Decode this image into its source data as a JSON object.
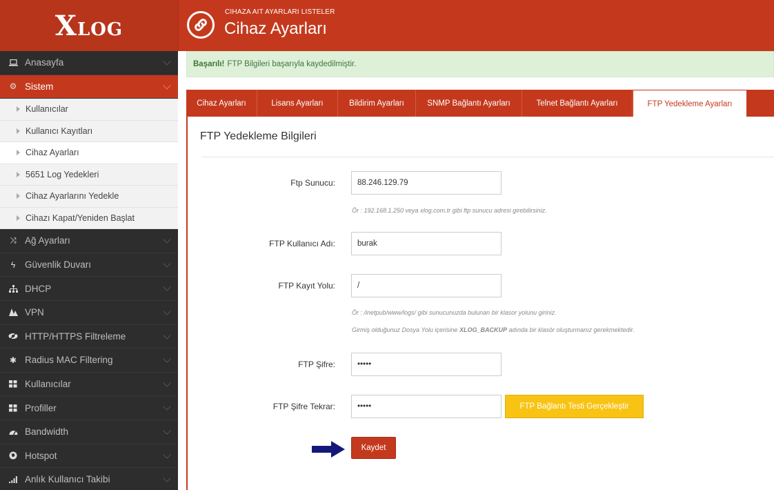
{
  "logo": {
    "initial": "X",
    "rest": "LOG"
  },
  "header": {
    "subtitle": "CIHAZA AIT AYARLARI LISTELER",
    "title": "Cihaz Ayarları"
  },
  "sidebar": {
    "items": [
      {
        "label": "Anasayfa",
        "icon": "laptop-icon"
      },
      {
        "label": "Sistem",
        "icon": "gears-icon",
        "active": true
      },
      {
        "label": "Ağ Ayarları",
        "icon": "random-icon"
      },
      {
        "label": "Güvenlik Duvarı",
        "icon": "bolt-icon"
      },
      {
        "label": "DHCP",
        "icon": "sitemap-icon"
      },
      {
        "label": "VPN",
        "icon": "vpn-icon"
      },
      {
        "label": "HTTP/HTTPS Filtreleme",
        "icon": "eye-slash-icon"
      },
      {
        "label": "Radius MAC Filtering",
        "icon": "asterisk-icon"
      },
      {
        "label": "Kullanıcılar",
        "icon": "th-large-icon"
      },
      {
        "label": "Profiller",
        "icon": "th-large-icon"
      },
      {
        "label": "Bandwidth",
        "icon": "tachometer-icon"
      },
      {
        "label": "Hotspot",
        "icon": "globe-icon"
      },
      {
        "label": "Anlık Kullanıcı Takibi",
        "icon": "signal-icon"
      }
    ],
    "submenu": [
      "Kullanıcılar",
      "Kullanıcı Kayıtları",
      "Cihaz Ayarları",
      "5651 Log Yedekleri",
      "Cihaz Ayarlarını Yedekle",
      "Cihazı Kapat/Yeniden Başlat"
    ]
  },
  "alert": {
    "strong": "Başarılı!",
    "text": "FTP Bilgileri başarıyla kaydedilmiştir."
  },
  "tabs": [
    "Cihaz Ayarları",
    "Lisans Ayarları",
    "Bildirim Ayarları",
    "SNMP Bağlantı Ayarları",
    "Telnet Bağlantı Ayarları",
    "FTP Yedekleme Ayarları"
  ],
  "form": {
    "title": "FTP Yedekleme Bilgileri",
    "server_label": "Ftp Sunucu:",
    "server_value": "88.246.129.79",
    "server_hint": "Ör : 192.168.1.250 veya xlog.com.tr gibi ftp sunucu adresi girebilirsiniz.",
    "user_label": "FTP Kullanıcı Adı:",
    "user_value": "burak",
    "path_label": "FTP Kayıt Yolu:",
    "path_value": "/",
    "path_hint1": "Ör : /inetpub/www/logs/ gibi sunucunuzda bulunan bir klasor yolunu giriniz.",
    "path_hint2_a": "Girmiş olduğunuz Dosya Yolu içerisine",
    "path_hint2_b": "XLOG_BACKUP",
    "path_hint2_c": "adında bir klasör oluşturmanız gerekmektedir.",
    "pass_label": "FTP Şifre:",
    "pass_value": "•••••",
    "pass2_label": "FTP Şifre Tekrar:",
    "pass2_value": "•••••",
    "test_button": "FTP Bağlantı Testi Gerçekleştir",
    "save_button": "Kaydet"
  },
  "colors": {
    "brand": "#c4391d",
    "sidebar": "#2d2d2d",
    "success_bg": "#dff0d8",
    "warning": "#f8c313",
    "arrow": "#14187a"
  }
}
